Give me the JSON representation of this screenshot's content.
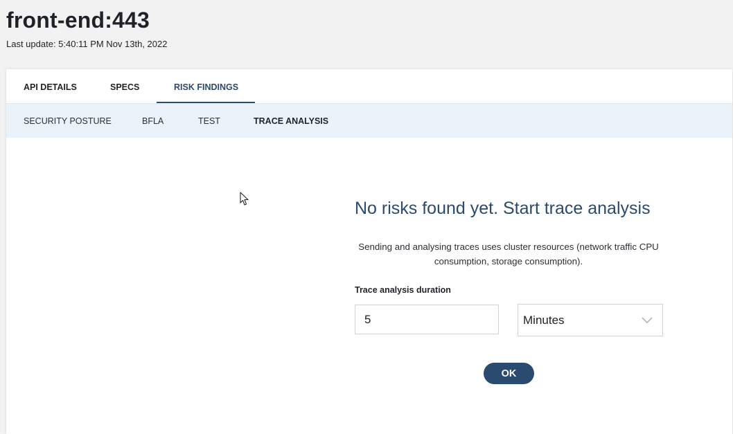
{
  "header": {
    "title": "front-end:443",
    "last_update": "Last update: 5:40:11 PM Nov 13th, 2022"
  },
  "tabs": [
    {
      "label": "API DETAILS",
      "active": false
    },
    {
      "label": "SPECS",
      "active": false
    },
    {
      "label": "RISK FINDINGS",
      "active": true
    }
  ],
  "subtabs": [
    {
      "label": "SECURITY POSTURE",
      "active": false
    },
    {
      "label": "BFLA",
      "active": false
    },
    {
      "label": "TEST",
      "active": false
    },
    {
      "label": "TRACE ANALYSIS",
      "active": true
    }
  ],
  "trace_analysis": {
    "title": "No risks found yet. Start trace analysis",
    "description": "Sending and analysing traces uses cluster resources (network traffic CPU consumption, storage consumption).",
    "duration_label": "Trace analysis duration",
    "duration_value": "5",
    "unit_value": "Minutes",
    "ok_label": "OK"
  },
  "colors": {
    "accent": "#2b4a6f",
    "subtab_bg": "#eaf3fa",
    "page_bg": "#f2f2f2"
  },
  "icons": {
    "select_chevron": "chevron-down-icon",
    "cursor": "mouse-pointer-icon"
  }
}
